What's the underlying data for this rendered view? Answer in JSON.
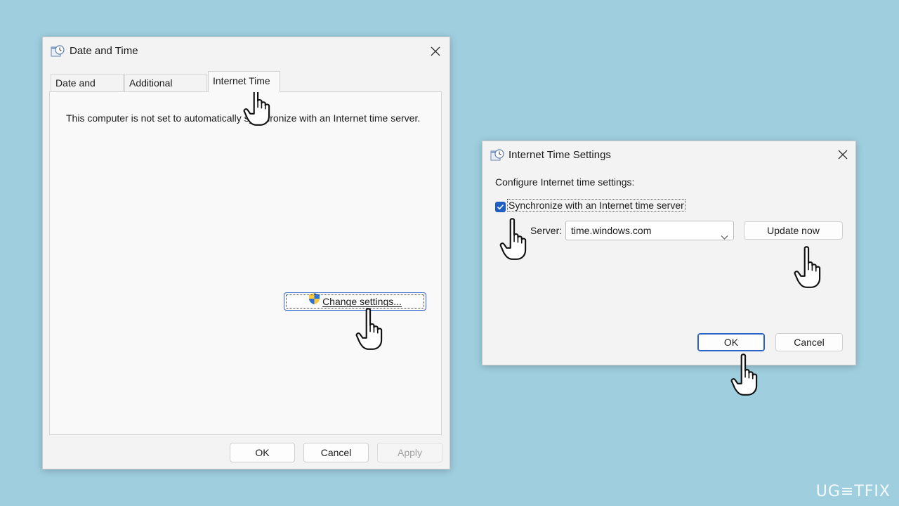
{
  "main_window": {
    "title": "Date and Time",
    "tabs": [
      {
        "label": "Date and Time"
      },
      {
        "label": "Additional Clocks"
      },
      {
        "label": "Internet Time"
      }
    ],
    "message": "This computer is not set to automatically synchronize with an Internet time server.",
    "change_settings_label": "Change settings...",
    "ok_label": "OK",
    "cancel_label": "Cancel",
    "apply_label": "Apply"
  },
  "dialog": {
    "title": "Internet Time Settings",
    "heading": "Configure Internet time settings:",
    "sync_label": "Synchronize with an Internet time server",
    "sync_checked": true,
    "server_label": "Server:",
    "server_value": "time.windows.com",
    "update_now_label": "Update now",
    "ok_label": "OK",
    "cancel_label": "Cancel"
  },
  "watermark": {
    "text": "UG≡TFIX"
  },
  "colors": {
    "background": "#9fcfdf",
    "accent": "#1f5fc3",
    "window": "#f3f3f3"
  },
  "icons": [
    "date-time-icon",
    "close-icon",
    "uac-shield-icon",
    "checkmark-icon",
    "chevron-down-icon",
    "pointer-hand-icon"
  ]
}
